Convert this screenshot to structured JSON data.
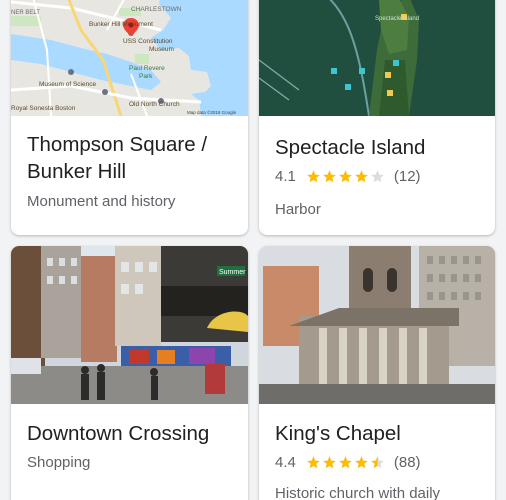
{
  "colors": {
    "star_filled": "#fbbc04",
    "star_empty": "#dadce0",
    "title_text": "#202124",
    "secondary_text": "#5f6368"
  },
  "cards": [
    {
      "title_line1": "Thompson Square /",
      "title_line2": "Bunker Hill",
      "category": "Monument and history",
      "image": {
        "kind": "map",
        "labels": {
          "area_1": "CHARLESTOWN",
          "area_2": "NER BELT",
          "poi_1": "Bunker Hill Monument",
          "poi_2": "USS Constitution",
          "poi_2b": "Museum",
          "poi_3": "Paul Revere",
          "poi_3b": "Park",
          "poi_4": "Museum of Science",
          "poi_5": "Royal Sonesta Boston",
          "poi_6": "Old North Church",
          "attribution": "Map data ©2018 Google"
        }
      }
    },
    {
      "title": "Spectacle Island",
      "rating": "4.1",
      "stars": 4,
      "reviews": "(12)",
      "category": "Harbor",
      "image": {
        "kind": "aerial",
        "label": "Spectacle Island"
      }
    },
    {
      "title": "Downtown Crossing",
      "category": "Shopping",
      "image": {
        "kind": "street",
        "sign": "Summer"
      }
    },
    {
      "title": "King's Chapel",
      "rating": "4.4",
      "stars": 4.5,
      "reviews": "(88)",
      "category": "Historic church with daily",
      "image": {
        "kind": "church"
      }
    }
  ]
}
